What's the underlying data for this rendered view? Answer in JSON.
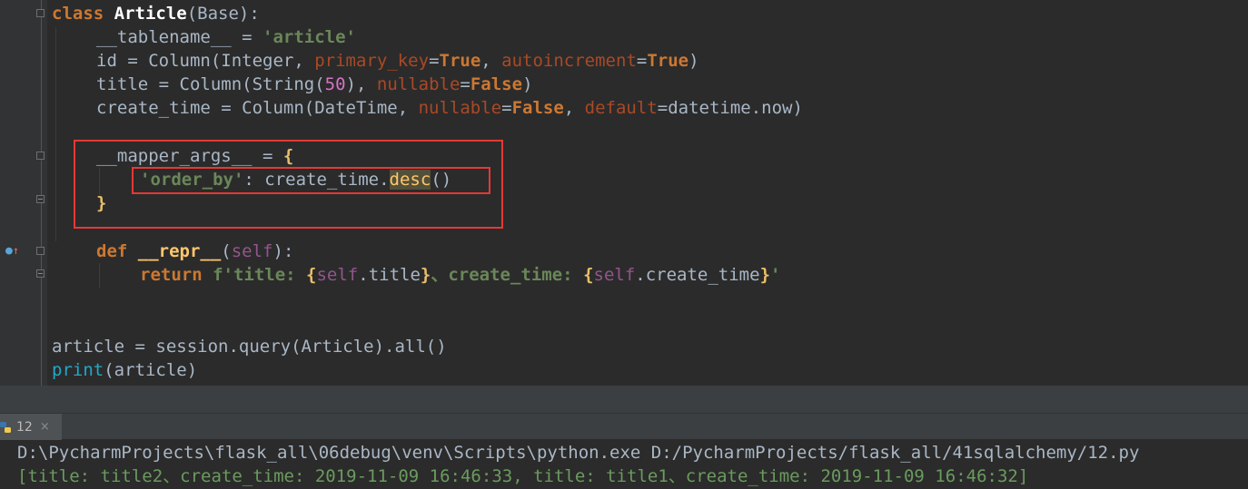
{
  "editor": {
    "lines": {
      "l1": {
        "kw": "class",
        "name": "Article",
        "rest": "(Base):"
      },
      "l2": {
        "a": "__tablename__ = ",
        "s": "'article'"
      },
      "l3": {
        "a": "id = Column(Integer, ",
        "p1": "primary_key",
        "eq1": "=",
        "v1": "True",
        "c1": ", ",
        "p2": "autoincrement",
        "eq2": "=",
        "v2": "True",
        "end": ")"
      },
      "l4": {
        "a": "title = Column(String(",
        "n": "50",
        "b": "), ",
        "p": "nullable",
        "eq": "=",
        "v": "False",
        "end": ")"
      },
      "l5": {
        "a": "create_time = Column(DateTime, ",
        "p1": "nullable",
        "eq1": "=",
        "v1": "False",
        "c": ", ",
        "p2": "default",
        "eq2": "=",
        "end": "datetime.now)"
      },
      "l6": {
        "a": "__mapper_args__ = ",
        "b": "{"
      },
      "l7": {
        "s": "'order_by'",
        "a": ": create_time.",
        "h": "desc",
        "end": "()"
      },
      "l8": {
        "b": "}"
      },
      "l9": {
        "kw": "def ",
        "fn": "__repr__",
        "a": "(",
        "self": "self",
        "end": "):"
      },
      "l10": {
        "kw": "return ",
        "f": "f'title: ",
        "b1": "{",
        "self1": "self",
        "t1": ".title",
        "b2": "}",
        "mid": "、create_time: ",
        "b3": "{",
        "self2": "self",
        "t2": ".create_time",
        "b4": "}",
        "q": "'"
      },
      "l11": {
        "a": "article = session.query(Article).all()"
      },
      "l12": {
        "p": "print",
        "a": "(article)"
      }
    }
  },
  "run_panel": {
    "tab_label": "12",
    "close_glyph": "×",
    "console": {
      "command": "D:\\PycharmProjects\\flask_all\\06debug\\venv\\Scripts\\python.exe D:/PycharmProjects/flask_all/41sqlalchemy/12.py",
      "output": "[title: title2、create_time: 2019-11-09 16:46:33, title: title1、create_time: 2019-11-09 16:46:32]"
    }
  },
  "colors": {
    "editor_bg": "#2b2b2b",
    "keyword": "#cc7832",
    "string": "#6a8759",
    "param": "#aa4926",
    "self": "#94558d",
    "highlight_box": "#e53935",
    "console_cmd": "#a9b7c6",
    "console_out": "#5e9955"
  },
  "icons": [
    "python-file-icon",
    "override-method-icon",
    "fold-marker-icon",
    "close-icon"
  ]
}
